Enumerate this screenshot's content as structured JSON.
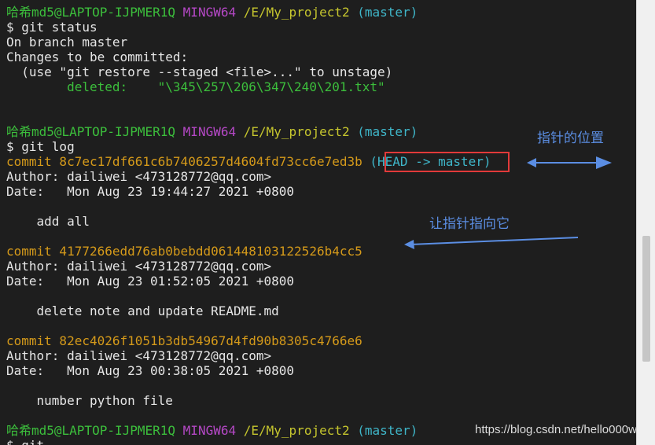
{
  "prompt": {
    "user_host": "哈希md5@LAPTOP-IJPMER1Q",
    "shell": "MINGW64",
    "path": "/E/My_project2",
    "branch": "(master)"
  },
  "lines": {
    "cmd1": "$ git status",
    "status1": "On branch master",
    "status2": "Changes to be committed:",
    "status3": "  (use \"git restore --staged <file>...\" to unstage)",
    "deleted_label": "        deleted:    ",
    "deleted_file": "\"\\345\\257\\206\\347\\240\\201.txt\"",
    "cmd2": "$ git log",
    "commit1_label": "commit 8c7ec17df661c6b7406257d4604fd73cc6e7ed3b",
    "commit1_ref": "(HEAD -> master)",
    "author1": "Author: dailiwei <473128772@qq.com>",
    "date1": "Date:   Mon Aug 23 19:44:27 2021 +0800",
    "msg1": "    add all",
    "commit2_label": "commit 4177266edd76ab0bebdd061448103122526b4cc5",
    "author2": "Author: dailiwei <473128772@qq.com>",
    "date2": "Date:   Mon Aug 23 01:52:05 2021 +0800",
    "msg2": "    delete note and update README.md",
    "commit3_label": "commit 82ec4026f1051b3db54967d4fd90b8305c4766e6",
    "author3": "Author: dailiwei <473128772@qq.com>",
    "date3": "Date:   Mon Aug 23 00:38:05 2021 +0800",
    "msg3": "    number python file",
    "cmd3": "$ git"
  },
  "annotations": {
    "pointer_position": "指针的位置",
    "point_it_here": "让指针指向它"
  },
  "watermark": "https://blog.csdn.net/hello000w",
  "colors": {
    "background": "#1e1e1e",
    "prompt_user": "#3cbf3c",
    "prompt_shell": "#b548c6",
    "prompt_path": "#c6c62e",
    "prompt_branch": "#3fb6c9",
    "commit_hash": "#d59a1a",
    "annotation": "#5b8ee3",
    "highlight_box": "#e23a3a"
  }
}
